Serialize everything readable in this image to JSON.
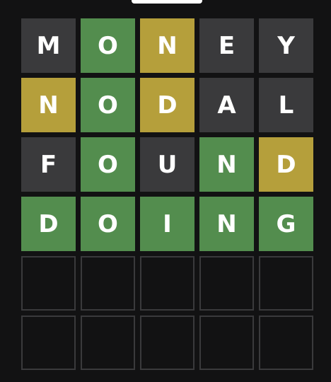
{
  "colors": {
    "background": "#121213",
    "absent": "#3a3a3c",
    "correct": "#538d4e",
    "present": "#b59f3b",
    "empty_border": "#3a3a3c"
  },
  "board": {
    "rows": [
      {
        "letters": [
          "M",
          "O",
          "N",
          "E",
          "Y"
        ],
        "states": [
          "absent",
          "correct",
          "present",
          "absent",
          "absent"
        ]
      },
      {
        "letters": [
          "N",
          "O",
          "D",
          "A",
          "L"
        ],
        "states": [
          "present",
          "correct",
          "present",
          "absent",
          "absent"
        ]
      },
      {
        "letters": [
          "F",
          "O",
          "U",
          "N",
          "D"
        ],
        "states": [
          "absent",
          "correct",
          "absent",
          "correct",
          "present"
        ]
      },
      {
        "letters": [
          "D",
          "O",
          "I",
          "N",
          "G"
        ],
        "states": [
          "correct",
          "correct",
          "correct",
          "correct",
          "correct"
        ]
      },
      {
        "letters": [
          "",
          "",
          "",
          "",
          ""
        ],
        "states": [
          "empty",
          "empty",
          "empty",
          "empty",
          "empty"
        ]
      },
      {
        "letters": [
          "",
          "",
          "",
          "",
          ""
        ],
        "states": [
          "empty",
          "empty",
          "empty",
          "empty",
          "empty"
        ]
      }
    ]
  }
}
